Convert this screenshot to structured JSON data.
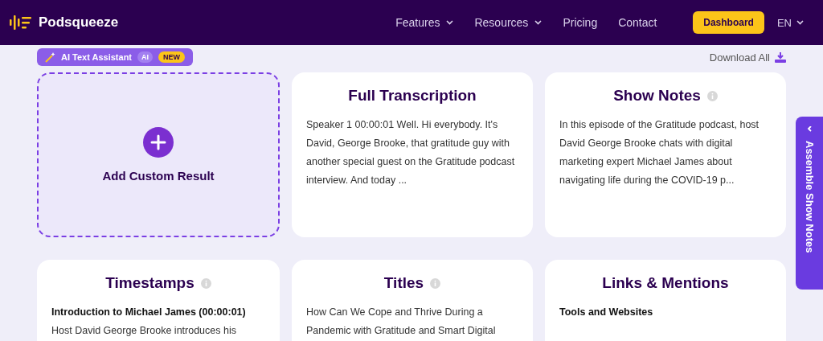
{
  "header": {
    "brand": "Podsqueeze",
    "nav": [
      {
        "label": "Features",
        "dropdown": true
      },
      {
        "label": "Resources",
        "dropdown": true
      },
      {
        "label": "Pricing",
        "dropdown": false
      },
      {
        "label": "Contact",
        "dropdown": false
      }
    ],
    "dashboard": "Dashboard",
    "language": "EN"
  },
  "toolbar": {
    "assistant": "AI Text Assistant",
    "ai_badge": "AI",
    "new_badge": "NEW",
    "download": "Download All"
  },
  "add_card": {
    "label": "Add Custom Result"
  },
  "cards": [
    {
      "title": "Full Transcription",
      "info": false,
      "paragraphs": [
        {
          "text": "Speaker 1 00:00:01  Well. Hi everybody. It's David, George Brooke, that gratitude guy with another special guest on the Gratitude podcast interview. And today ...",
          "bold": false
        }
      ]
    },
    {
      "title": "Show Notes",
      "info": true,
      "paragraphs": [
        {
          "text": "In this episode of the Gratitude podcast, host David George Brooke chats with digital marketing expert Michael James about navigating life during the COVID-19 p...",
          "bold": false
        }
      ]
    },
    {
      "title": "Timestamps",
      "info": true,
      "paragraphs": [
        {
          "text": "Introduction to Michael James (00:00:01)",
          "bold": true
        },
        {
          "text": "Host David George Brooke introduces his",
          "bold": false
        }
      ]
    },
    {
      "title": "Titles",
      "info": true,
      "paragraphs": [
        {
          "text": "How Can We Cope and Thrive During a Pandemic with Gratitude and Smart Digital",
          "bold": false
        }
      ]
    },
    {
      "title": "Links & Mentions",
      "info": false,
      "paragraphs": [
        {
          "text": "Tools and Websites",
          "bold": true
        }
      ]
    }
  ],
  "side_tab": {
    "label": "Assemble Show Notes"
  }
}
